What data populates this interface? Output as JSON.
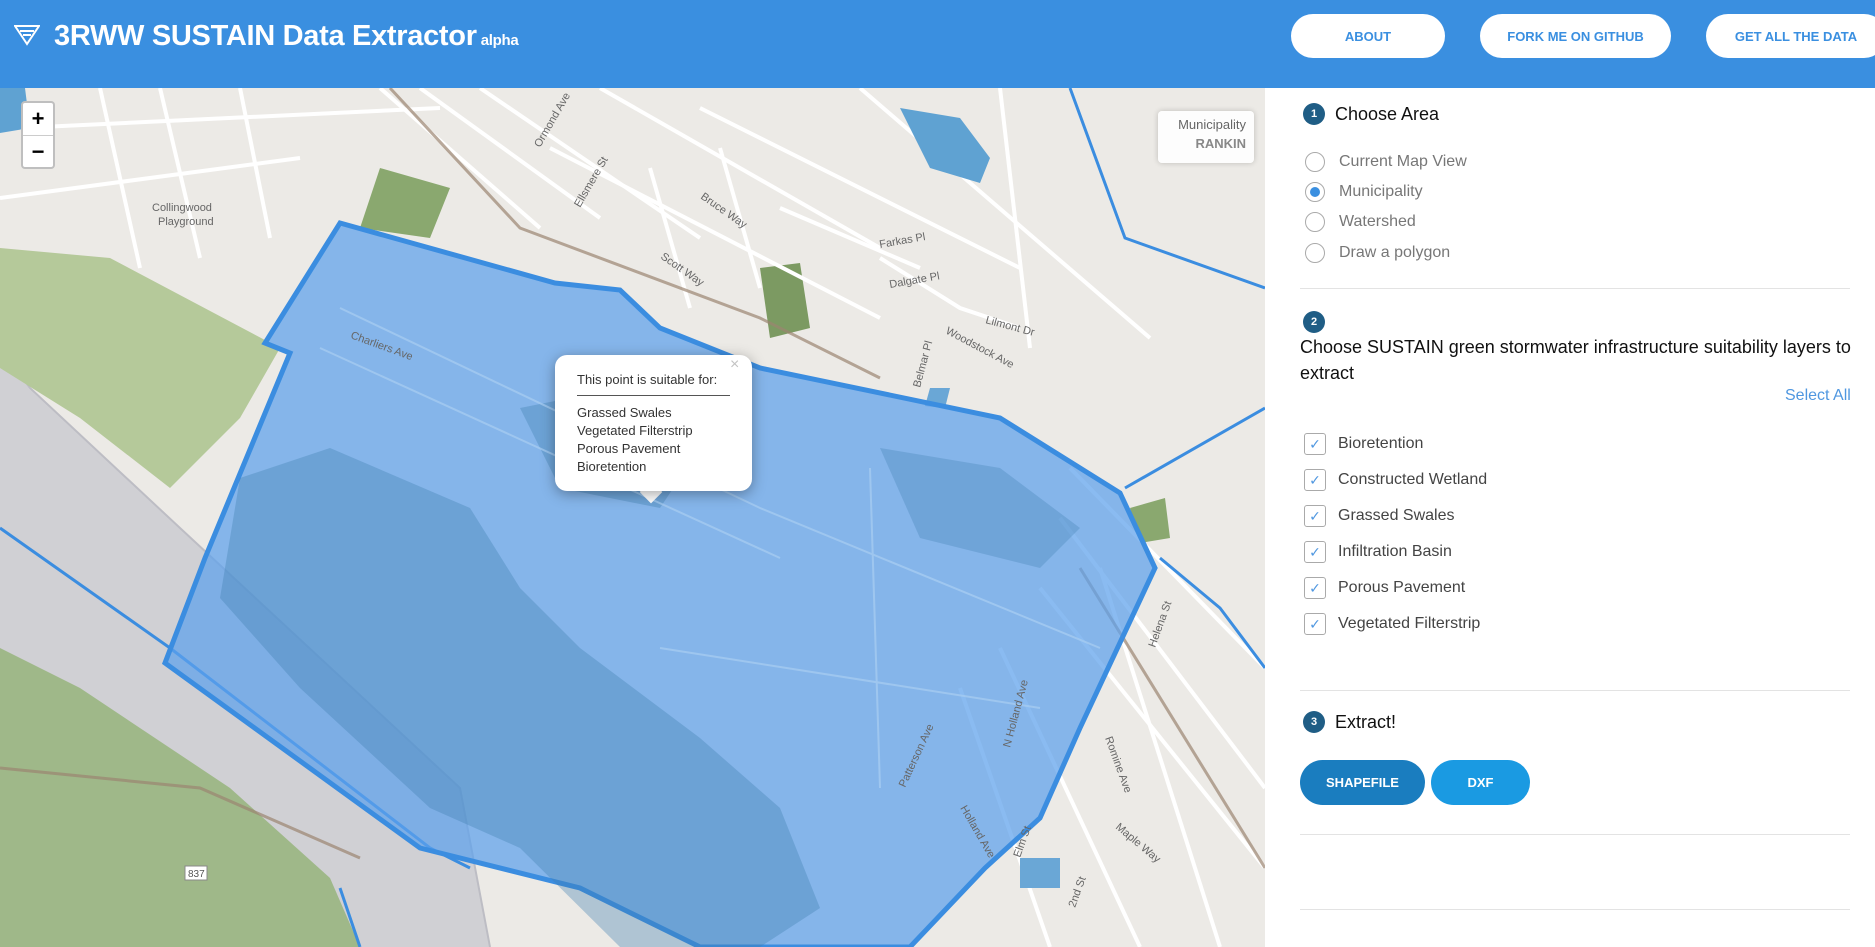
{
  "app": {
    "title": "3RWW SUSTAIN Data Extractor",
    "badge": "alpha",
    "logo_icon": "funnel-logo-icon",
    "accent_color": "#3a8fe0"
  },
  "header": {
    "about_label": "ABOUT",
    "fork_label": "FORK ME ON GITHUB",
    "data_label": "GET ALL THE DATA"
  },
  "map": {
    "zoom_in": "+",
    "zoom_out": "−",
    "info_label": "Municipality",
    "info_value": "RANKIN",
    "popup": {
      "close": "×",
      "title": "This point is suitable for:",
      "items": [
        "Grassed Swales",
        "Vegetated Filterstrip",
        "Porous Pavement",
        "Bioretention"
      ]
    },
    "street_labels": [
      "Collingwood",
      "Playground",
      "Ormond Ave",
      "Ellsmere St",
      "Bruce Way",
      "Scott Way",
      "Farkas Pl",
      "Dalgate Pl",
      "Lilmont Dr",
      "Woodstock Ave",
      "Belmar Pl",
      "Charliers Ave",
      "Holland Ave",
      "Patterson Ave",
      "N Holland Ave",
      "Helena St",
      "Romine Ave",
      "Maple Way",
      "Elm St",
      "2nd St",
      "837"
    ]
  },
  "sidebar": {
    "step1": {
      "num": "1",
      "title": "Choose Area"
    },
    "area_options": [
      {
        "label": "Current Map View",
        "selected": false
      },
      {
        "label": "Municipality",
        "selected": true
      },
      {
        "label": "Watershed",
        "selected": false
      },
      {
        "label": "Draw a polygon",
        "selected": false
      }
    ],
    "step2": {
      "num": "2",
      "title": "Choose SUSTAIN green stormwater infrastructure suitability layers to extract"
    },
    "select_all": "Select All",
    "layers": [
      {
        "label": "Bioretention",
        "checked": true
      },
      {
        "label": "Constructed Wetland",
        "checked": true
      },
      {
        "label": "Grassed Swales",
        "checked": true
      },
      {
        "label": "Infiltration Basin",
        "checked": true
      },
      {
        "label": "Porous Pavement",
        "checked": true
      },
      {
        "label": "Vegetated Filterstrip",
        "checked": true
      }
    ],
    "check_mark": "✓",
    "step3": {
      "num": "3",
      "title": "Extract!"
    },
    "shapefile_label": "SHAPEFILE",
    "dxf_label": "DXF"
  }
}
